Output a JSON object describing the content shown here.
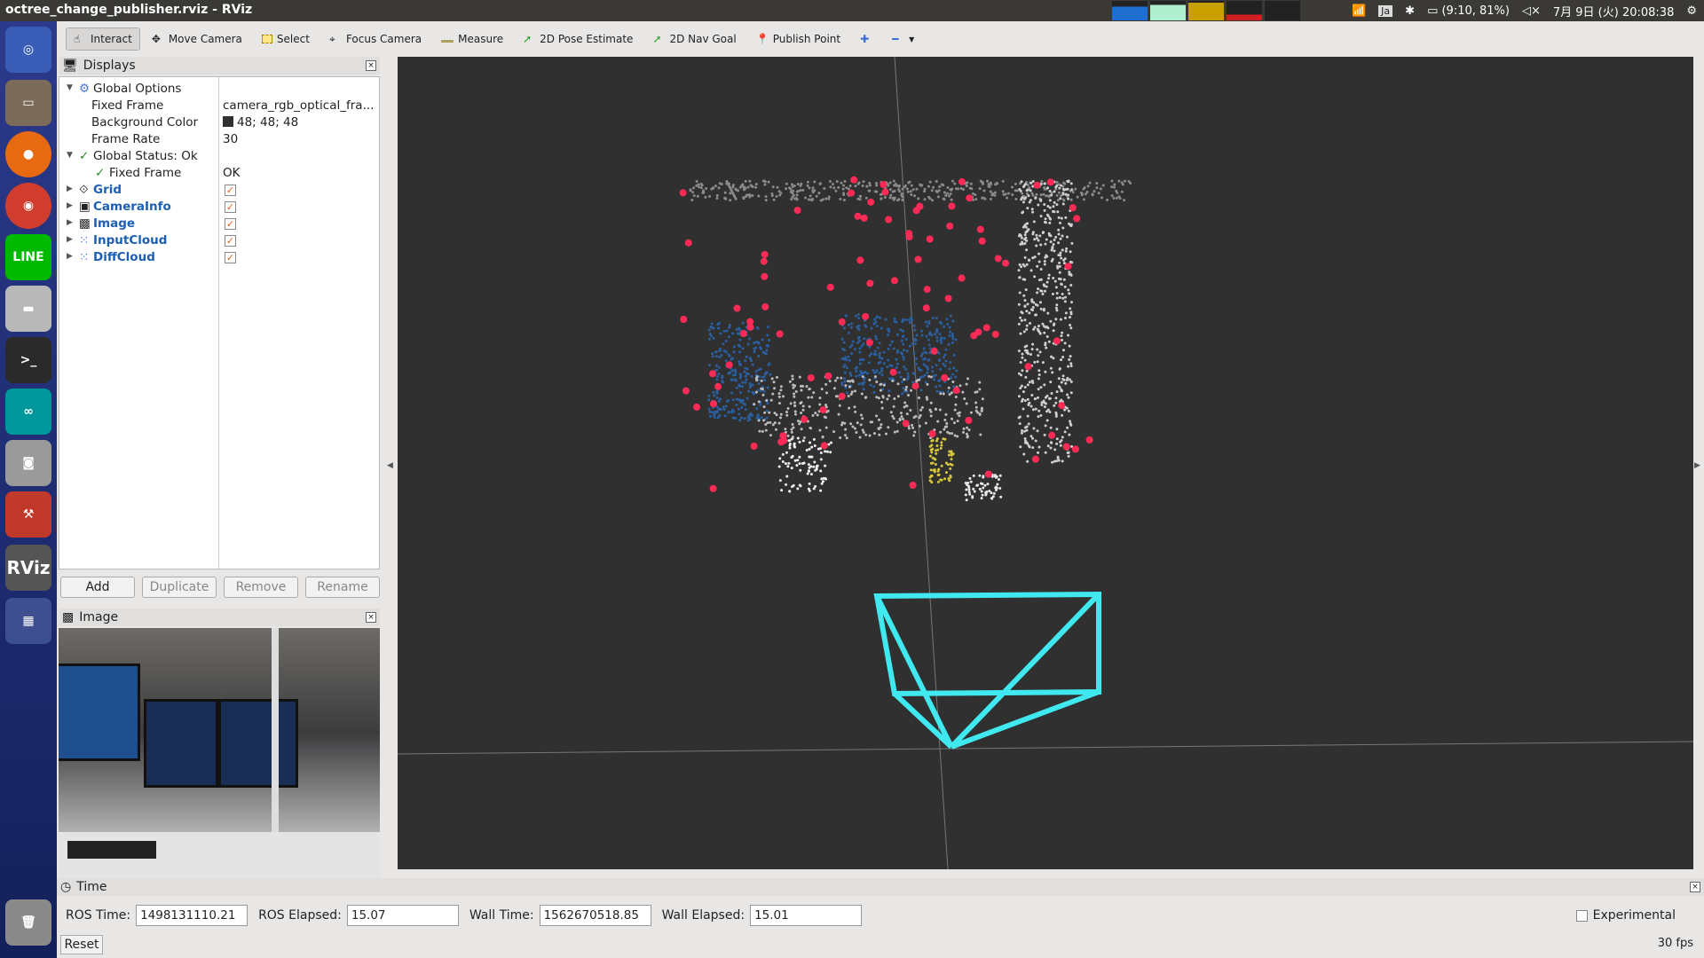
{
  "window_title": "octree_change_publisher.rviz - RViz",
  "topbar": {
    "language": "Ja",
    "battery": "(9:10, 81%)",
    "datetime": "7月 9日 (火) 20:08:38"
  },
  "launcher": [
    "ubuntu",
    "files",
    "firefox",
    "chrome",
    "LINE",
    "disk",
    "terminal",
    "arduino",
    "camera",
    "settings",
    "RViz",
    "workspace",
    "trash"
  ],
  "toolbar": {
    "tools": [
      {
        "label": "Interact",
        "icon": "hand-icon",
        "active": true
      },
      {
        "label": "Move Camera",
        "icon": "move-camera-icon"
      },
      {
        "label": "Select",
        "icon": "select-icon"
      },
      {
        "label": "Focus Camera",
        "icon": "focus-camera-icon"
      },
      {
        "label": "Measure",
        "icon": "measure-icon"
      },
      {
        "label": "2D Pose Estimate",
        "icon": "pose-arrow-icon"
      },
      {
        "label": "2D Nav Goal",
        "icon": "nav-arrow-icon"
      },
      {
        "label": "Publish Point",
        "icon": "pin-icon"
      }
    ]
  },
  "displays": {
    "title": "Displays",
    "global_options": "Global Options",
    "fixed_frame_label": "Fixed Frame",
    "fixed_frame_value": "camera_rgb_optical_fra...",
    "bg_color_label": "Background Color",
    "bg_color_value": "48; 48; 48",
    "frame_rate_label": "Frame Rate",
    "frame_rate_value": "30",
    "global_status": "Global Status: Ok",
    "fixed_frame_status_label": "Fixed Frame",
    "fixed_frame_status_value": "OK",
    "items": [
      "Grid",
      "CameraInfo",
      "Image",
      "InputCloud",
      "DiffCloud"
    ],
    "buttons": {
      "add": "Add",
      "duplicate": "Duplicate",
      "remove": "Remove",
      "rename": "Rename"
    }
  },
  "image_panel": {
    "title": "Image"
  },
  "time_panel": {
    "title": "Time",
    "ros_time_label": "ROS Time:",
    "ros_time": "1498131110.21",
    "ros_elapsed_label": "ROS Elapsed:",
    "ros_elapsed": "15.07",
    "wall_time_label": "Wall Time:",
    "wall_time": "1562670518.85",
    "wall_elapsed_label": "Wall Elapsed:",
    "wall_elapsed": "15.01",
    "experimental": "Experimental",
    "reset": "Reset",
    "fps": "30 fps"
  },
  "colors": {
    "view_bg": "#303030",
    "frustum": "#40e8f0",
    "diff_points": "#ff2a55",
    "cloud_blue": "#2a5fa0"
  }
}
